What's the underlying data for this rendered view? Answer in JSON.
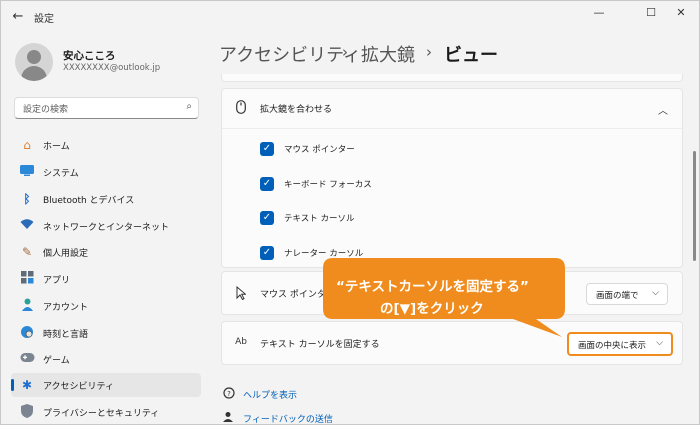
{
  "window": {
    "title": "設定"
  },
  "profile": {
    "name": "安心こころ",
    "email": "XXXXXXXX@outlook.jp"
  },
  "search": {
    "placeholder": "設定の検索"
  },
  "nav": [
    {
      "label": "ホーム",
      "icon": "home-icon"
    },
    {
      "label": "システム",
      "icon": "system-icon"
    },
    {
      "label": "Bluetooth とデバイス",
      "icon": "bluetooth-icon"
    },
    {
      "label": "ネットワークとインターネット",
      "icon": "wifi-icon"
    },
    {
      "label": "個人用設定",
      "icon": "brush-icon"
    },
    {
      "label": "アプリ",
      "icon": "apps-icon"
    },
    {
      "label": "アカウント",
      "icon": "account-icon"
    },
    {
      "label": "時刻と言語",
      "icon": "globe-icon"
    },
    {
      "label": "ゲーム",
      "icon": "gamepad-icon"
    },
    {
      "label": "アクセシビリティ",
      "icon": "accessibility-icon",
      "active": true
    },
    {
      "label": "プライバシーとセキュリティ",
      "icon": "shield-icon"
    }
  ],
  "breadcrumb": {
    "level1": "アクセシビリティ",
    "level2": "拡大鏡",
    "current": "ビュー",
    "separator": "›"
  },
  "follow": {
    "title": "拡大鏡を合わせる",
    "options": [
      {
        "label": "マウス ポインター",
        "checked": true
      },
      {
        "label": "キーボード フォーカス",
        "checked": true
      },
      {
        "label": "テキスト カーソル",
        "checked": true
      },
      {
        "label": "ナレーター カーソル",
        "checked": true
      }
    ]
  },
  "mouse_pointer": {
    "title": "マウス ポインターを",
    "value": "画面の端で"
  },
  "text_cursor": {
    "title": "テキスト カーソルを固定する",
    "value": "画面の中央に表示",
    "icon_text": "Ab"
  },
  "links": {
    "help": "ヘルプを表示",
    "feedback": "フィードバックの送信"
  },
  "callout": {
    "line1": "“テキストカーソルを固定する”",
    "line2": "の[▼]をクリック",
    "color": "#f08c1e"
  },
  "colors": {
    "accent": "#005fb8",
    "callout": "#f08c1e"
  }
}
